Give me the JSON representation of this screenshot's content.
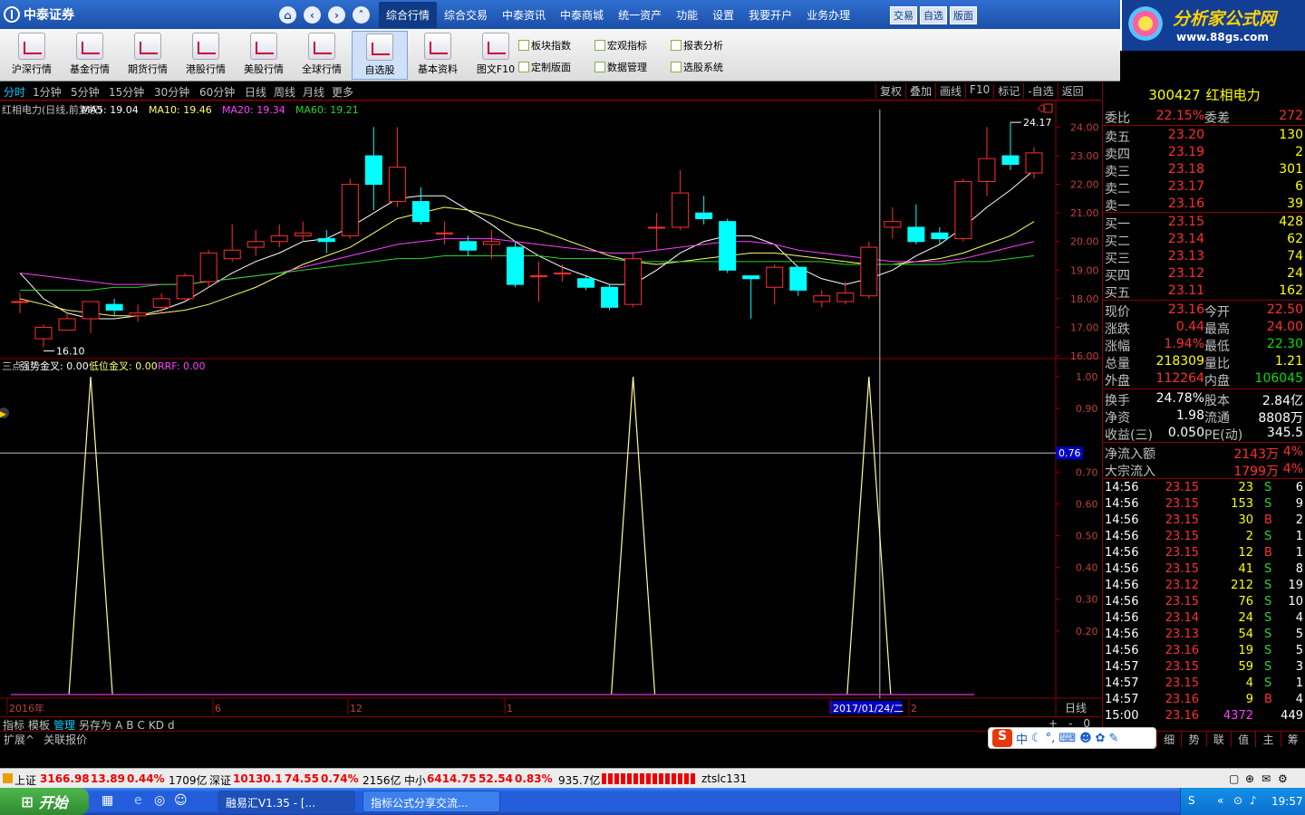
{
  "app": {
    "logo_text": "中泰证券",
    "nav_icons": [
      "home-icon",
      "back-icon",
      "forward-icon",
      "up-icon"
    ]
  },
  "top_menu": [
    "综合行情",
    "综合交易",
    "中泰资讯",
    "中泰商城",
    "统一资产",
    "功能",
    "设置",
    "我要开户",
    "业务办理"
  ],
  "top_menu_active": 0,
  "trade_buttons": [
    "交易",
    "自选",
    "版面"
  ],
  "ad": {
    "title": "分析家公式网",
    "url": "www.88gs.com"
  },
  "toolbar": [
    "沪深行情",
    "基金行情",
    "期货行情",
    "港股行情",
    "美股行情",
    "全球行情",
    "自选股",
    "基本资料",
    "图文F10"
  ],
  "toolbar_selected": 6,
  "small_tools": [
    [
      "板块指数",
      "宏观指标",
      "报表分析"
    ],
    [
      "定制版面",
      "数据管理",
      "选股系统"
    ]
  ],
  "periods": [
    "分时",
    "1分钟",
    "5分钟",
    "15分钟",
    "30分钟",
    "60分钟",
    "日线",
    "周线",
    "月线",
    "更多"
  ],
  "period_active": 0,
  "right_buttons": [
    "复权",
    "叠加",
    "画线",
    "F10",
    "标记",
    "-自选",
    "返回"
  ],
  "main_chart": {
    "legend": [
      {
        "text": "红相电力(日线,前复权)",
        "color": "#c0c0c0"
      },
      {
        "text": "MA5: 19.04",
        "color": "#ffffff"
      },
      {
        "text": "MA10: 19.46",
        "color": "#ffff66"
      },
      {
        "text": "MA20: 19.34",
        "color": "#ff40ff"
      },
      {
        "text": "MA60: 19.21",
        "color": "#2ad62a"
      }
    ],
    "y_ticks": [
      "24.00",
      "23.00",
      "22.00",
      "21.00",
      "20.00",
      "19.00",
      "18.00",
      "17.00",
      "16.00"
    ],
    "high_label": "24.17",
    "low_label": "16.10"
  },
  "sub_chart": {
    "legend": [
      {
        "text": "三点",
        "color": "#c0c0c0"
      },
      {
        "text": "强势金叉: 0.00",
        "color": "#ffffff"
      },
      {
        "text": "低位金叉: 0.00",
        "color": "#ffff66"
      },
      {
        "text": "RRF: 0.00",
        "color": "#ff40ff"
      }
    ],
    "y_ticks": [
      "1.00",
      "0.90",
      "0.70",
      "0.60",
      "0.50",
      "0.40",
      "0.30",
      "0.20"
    ],
    "cursor_value": "0.76"
  },
  "chart_data": {
    "type": "candlestick",
    "title": "红相电力(日线,前复权)",
    "ylim": [
      16,
      24.3
    ],
    "candles": [
      {
        "o": 17.9,
        "c": 17.9,
        "h": 18.2,
        "l": 17.5
      },
      {
        "o": 16.6,
        "c": 17.0,
        "h": 17.1,
        "l": 16.3
      },
      {
        "o": 16.9,
        "c": 17.3,
        "h": 17.5,
        "l": 16.9
      },
      {
        "o": 17.3,
        "c": 17.9,
        "h": 17.9,
        "l": 16.8
      },
      {
        "o": 17.8,
        "c": 17.6,
        "h": 18.0,
        "l": 17.4
      },
      {
        "o": 17.4,
        "c": 17.5,
        "h": 17.8,
        "l": 17.2
      },
      {
        "o": 17.7,
        "c": 18.0,
        "h": 18.2,
        "l": 17.5
      },
      {
        "o": 18.0,
        "c": 18.8,
        "h": 18.9,
        "l": 17.9
      },
      {
        "o": 18.6,
        "c": 19.6,
        "h": 19.7,
        "l": 18.4
      },
      {
        "o": 19.4,
        "c": 19.7,
        "h": 20.6,
        "l": 19.3
      },
      {
        "o": 19.8,
        "c": 20.0,
        "h": 20.4,
        "l": 19.5
      },
      {
        "o": 20.0,
        "c": 20.2,
        "h": 20.6,
        "l": 19.8
      },
      {
        "o": 20.2,
        "c": 20.3,
        "h": 20.7,
        "l": 20.0
      },
      {
        "o": 20.1,
        "c": 20.0,
        "h": 20.4,
        "l": 19.6
      },
      {
        "o": 20.2,
        "c": 22.0,
        "h": 22.2,
        "l": 20.1
      },
      {
        "o": 23.0,
        "c": 22.0,
        "h": 24.0,
        "l": 21.1
      },
      {
        "o": 21.4,
        "c": 22.6,
        "h": 24.0,
        "l": 21.2
      },
      {
        "o": 21.4,
        "c": 20.7,
        "h": 21.9,
        "l": 20.6
      },
      {
        "o": 20.3,
        "c": 20.3,
        "h": 20.7,
        "l": 19.9
      },
      {
        "o": 20.0,
        "c": 19.7,
        "h": 20.2,
        "l": 19.5
      },
      {
        "o": 19.9,
        "c": 20.0,
        "h": 20.4,
        "l": 19.4
      },
      {
        "o": 19.8,
        "c": 18.5,
        "h": 20.0,
        "l": 18.4
      },
      {
        "o": 18.8,
        "c": 18.8,
        "h": 19.3,
        "l": 17.9
      },
      {
        "o": 18.9,
        "c": 18.9,
        "h": 19.2,
        "l": 18.6
      },
      {
        "o": 18.7,
        "c": 18.4,
        "h": 18.8,
        "l": 18.3
      },
      {
        "o": 18.4,
        "c": 17.7,
        "h": 18.5,
        "l": 17.6
      },
      {
        "o": 17.8,
        "c": 19.4,
        "h": 19.6,
        "l": 17.7
      },
      {
        "o": 20.5,
        "c": 20.5,
        "h": 21.0,
        "l": 19.7
      },
      {
        "o": 20.5,
        "c": 21.7,
        "h": 22.5,
        "l": 20.4
      },
      {
        "o": 21.0,
        "c": 20.8,
        "h": 21.6,
        "l": 20.6
      },
      {
        "o": 20.7,
        "c": 19.0,
        "h": 20.8,
        "l": 18.9
      },
      {
        "o": 18.8,
        "c": 18.7,
        "h": 18.8,
        "l": 17.3
      },
      {
        "o": 18.4,
        "c": 19.1,
        "h": 19.2,
        "l": 17.8
      },
      {
        "o": 19.1,
        "c": 18.3,
        "h": 19.1,
        "l": 18.1
      },
      {
        "o": 17.9,
        "c": 18.1,
        "h": 18.3,
        "l": 17.7
      },
      {
        "o": 17.9,
        "c": 18.2,
        "h": 18.6,
        "l": 17.8
      },
      {
        "o": 18.1,
        "c": 19.8,
        "h": 20.0,
        "l": 18.0
      },
      {
        "o": 20.5,
        "c": 20.7,
        "h": 21.2,
        "l": 20.1
      },
      {
        "o": 20.5,
        "c": 20.0,
        "h": 21.3,
        "l": 19.9
      },
      {
        "o": 20.3,
        "c": 20.1,
        "h": 20.5,
        "l": 19.9
      },
      {
        "o": 20.1,
        "c": 22.1,
        "h": 22.2,
        "l": 20.0
      },
      {
        "o": 22.1,
        "c": 22.9,
        "h": 24.0,
        "l": 21.6
      },
      {
        "o": 23.0,
        "c": 22.7,
        "h": 24.17,
        "l": 22.5
      },
      {
        "o": 22.4,
        "c": 23.1,
        "h": 23.3,
        "l": 22.2
      }
    ],
    "ma": {
      "MA5": [
        18.9,
        18.0,
        17.5,
        17.3,
        17.3,
        17.4,
        17.6,
        17.9,
        18.4,
        18.9,
        19.3,
        19.6,
        20.0,
        20.1,
        20.5,
        21.0,
        21.5,
        21.6,
        21.6,
        21.1,
        20.6,
        20.0,
        19.5,
        19.1,
        18.8,
        18.5,
        18.5,
        19.0,
        19.6,
        20.0,
        20.2,
        20.2,
        19.9,
        19.1,
        18.7,
        18.5,
        18.7,
        19.0,
        19.5,
        19.9,
        20.5,
        21.2,
        21.8,
        22.5
      ],
      "MA10": [
        18.0,
        17.8,
        17.6,
        17.5,
        17.4,
        17.4,
        17.5,
        17.6,
        17.8,
        18.1,
        18.4,
        18.8,
        19.2,
        19.5,
        19.8,
        20.3,
        20.8,
        21.0,
        21.2,
        21.1,
        20.9,
        20.6,
        20.4,
        20.1,
        19.8,
        19.5,
        19.3,
        19.2,
        19.3,
        19.4,
        19.5,
        19.6,
        19.6,
        19.5,
        19.4,
        19.3,
        19.2,
        19.2,
        19.3,
        19.4,
        19.6,
        19.9,
        20.2,
        20.7
      ],
      "MA20": [
        18.9,
        18.8,
        18.7,
        18.6,
        18.5,
        18.5,
        18.5,
        18.5,
        18.6,
        18.7,
        18.8,
        18.9,
        19.1,
        19.3,
        19.5,
        19.7,
        19.9,
        20.0,
        20.1,
        20.1,
        20.1,
        20.0,
        19.9,
        19.8,
        19.7,
        19.6,
        19.6,
        19.7,
        19.8,
        19.9,
        20.0,
        20.0,
        19.9,
        19.7,
        19.6,
        19.5,
        19.4,
        19.3,
        19.3,
        19.3,
        19.4,
        19.6,
        19.8,
        20.0
      ],
      "MA60": [
        18.3,
        18.3,
        18.3,
        18.3,
        18.4,
        18.4,
        18.5,
        18.5,
        18.6,
        18.7,
        18.8,
        18.9,
        19.0,
        19.1,
        19.2,
        19.3,
        19.4,
        19.4,
        19.5,
        19.5,
        19.5,
        19.5,
        19.5,
        19.4,
        19.4,
        19.4,
        19.3,
        19.3,
        19.3,
        19.3,
        19.3,
        19.3,
        19.3,
        19.3,
        19.3,
        19.2,
        19.2,
        19.2,
        19.2,
        19.2,
        19.3,
        19.3,
        19.4,
        19.5
      ]
    },
    "indicator_peaks": [
      3,
      26,
      36
    ],
    "x_labels": [
      "2016年",
      "6",
      "12",
      "1",
      "2017/01/24/二",
      "2"
    ]
  },
  "stock": {
    "code": "300427",
    "name": "红相电力"
  },
  "quote": {
    "weibi": [
      "委比",
      "22.15%",
      "委差",
      "272"
    ],
    "asks": [
      [
        "卖五",
        "23.20",
        "130"
      ],
      [
        "卖四",
        "23.19",
        "2"
      ],
      [
        "卖三",
        "23.18",
        "301"
      ],
      [
        "卖二",
        "23.17",
        "6"
      ],
      [
        "卖一",
        "23.16",
        "39"
      ]
    ],
    "bids": [
      [
        "买一",
        "23.15",
        "428"
      ],
      [
        "买二",
        "23.14",
        "62"
      ],
      [
        "买三",
        "23.13",
        "74"
      ],
      [
        "买四",
        "23.12",
        "24"
      ],
      [
        "买五",
        "23.11",
        "162"
      ]
    ],
    "stats": [
      [
        "现价",
        "23.16",
        "今开",
        "22.50"
      ],
      [
        "涨跌",
        "0.44",
        "最高",
        "24.00"
      ],
      [
        "涨幅",
        "1.94%",
        "最低",
        "22.30"
      ],
      [
        "总量",
        "218309",
        "量比",
        "1.21"
      ],
      [
        "外盘",
        "112264",
        "内盘",
        "106045"
      ]
    ],
    "stats2": [
      [
        "换手",
        "24.78%",
        "股本",
        "2.84亿"
      ],
      [
        "净资",
        "1.98",
        "流通",
        "8808万"
      ],
      [
        "收益(三)",
        "0.050",
        "PE(动)",
        "345.5"
      ]
    ],
    "flows": [
      [
        "净流入额",
        "2143万",
        "4%"
      ],
      [
        "大宗流入",
        "1799万",
        "4%"
      ]
    ]
  },
  "ticks": [
    [
      "14:56",
      "23.15",
      "23",
      "S",
      "6"
    ],
    [
      "14:56",
      "23.15",
      "153",
      "S",
      "9"
    ],
    [
      "14:56",
      "23.15",
      "30",
      "B",
      "2"
    ],
    [
      "14:56",
      "23.15",
      "2",
      "S",
      "1"
    ],
    [
      "14:56",
      "23.15",
      "12",
      "B",
      "1"
    ],
    [
      "14:56",
      "23.15",
      "41",
      "S",
      "8"
    ],
    [
      "14:56",
      "23.12",
      "212",
      "S",
      "19"
    ],
    [
      "14:56",
      "23.15",
      "76",
      "S",
      "10"
    ],
    [
      "14:56",
      "23.14",
      "24",
      "S",
      "4"
    ],
    [
      "14:56",
      "23.13",
      "54",
      "S",
      "5"
    ],
    [
      "14:56",
      "23.16",
      "19",
      "S",
      "5"
    ],
    [
      "14:57",
      "23.15",
      "59",
      "S",
      "3"
    ],
    [
      "14:57",
      "23.15",
      "4",
      "S",
      "1"
    ],
    [
      "14:57",
      "23.16",
      "9",
      "B",
      "4"
    ],
    [
      "15:00",
      "23.16",
      "4372",
      "",
      "449"
    ]
  ],
  "bottom_tabs": [
    "指标",
    "模板",
    "管理",
    "另存为",
    "A",
    "B",
    "C",
    "KD",
    "d"
  ],
  "bottom_tab_active": 2,
  "bottom_tabs2": [
    "扩展^",
    "关联报价"
  ],
  "period_label": "日线",
  "right_tabs": [
    "细",
    "势",
    "联",
    "值",
    "主",
    "筹"
  ],
  "zoom_ctrls": [
    "+",
    "-",
    "0"
  ],
  "status": {
    "sh_label": "上证",
    "sh": "3166.98",
    "sh_chg": "13.89",
    "sh_pct": "0.44%",
    "sh_amt": "1709亿",
    "sz_label": "深证",
    "sz": "10130.1",
    "sz_chg": "74.55",
    "sz_pct": "0.74%",
    "sz_amt": "2156亿",
    "zx_label": "中小",
    "zx": "6414.75",
    "zx_chg": "52.54",
    "zx_pct": "0.83%",
    "zx_amt": "935.7亿",
    "user": "ztslc131"
  },
  "taskbar": {
    "start": "开始",
    "tasks": [
      "融易汇V1.35 - [...",
      "指标公式分享交流..."
    ],
    "time": "19:57"
  },
  "ime": {
    "lang": "中"
  }
}
